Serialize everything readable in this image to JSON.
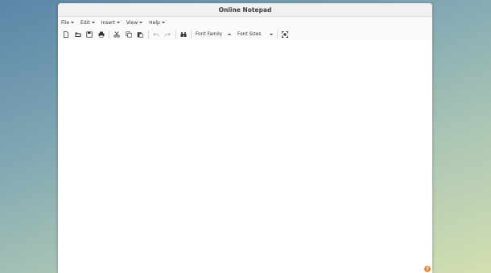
{
  "window": {
    "title": "Online Notepad"
  },
  "menu": {
    "file": "File",
    "edit": "Edit",
    "insert": "Insert",
    "view": "View",
    "help": "Help"
  },
  "toolbar": {
    "font_family": "Font Family",
    "font_sizes": "Font Sizes"
  },
  "help_badge": "?",
  "icons": [
    "new-file-icon",
    "open-file-icon",
    "save-icon",
    "print-icon",
    "cut-icon",
    "copy-icon",
    "paste-icon",
    "undo-icon",
    "redo-icon",
    "find-icon",
    "fullscreen-icon"
  ],
  "colors": {
    "accent_help": "#e8893a"
  }
}
